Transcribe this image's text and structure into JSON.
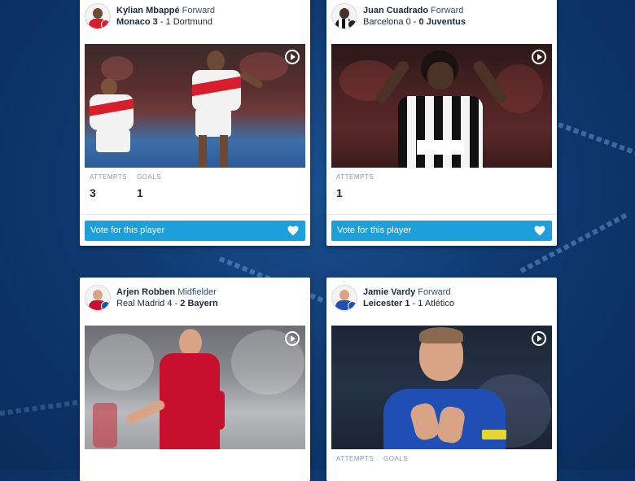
{
  "cards": [
    {
      "player_name": "Kylian Mbappé",
      "position": "Forward",
      "home_team": "Monaco",
      "home_score": "3",
      "away_score": "1",
      "away_team": "Dortmund",
      "winner": "home",
      "stats": [
        {
          "label": "ATTEMPTS",
          "value": "3"
        },
        {
          "label": "GOALS",
          "value": "1"
        }
      ],
      "vote_label": "Vote for this player",
      "play_icon": "play-icon"
    },
    {
      "player_name": "Juan Cuadrado",
      "position": "Forward",
      "home_team": "Barcelona",
      "home_score": "0",
      "away_score": "0",
      "away_team": "Juventus",
      "winner": "away",
      "stats": [
        {
          "label": "ATTEMPTS",
          "value": "1"
        }
      ],
      "vote_label": "Vote for this player",
      "play_icon": "play-icon"
    },
    {
      "player_name": "Arjen Robben",
      "position": "Midfielder",
      "home_team": "Real Madrid",
      "home_score": "4",
      "away_score": "2",
      "away_team": "Bayern",
      "winner": "away",
      "play_icon": "play-icon"
    },
    {
      "player_name": "Jamie Vardy",
      "position": "Forward",
      "home_team": "Leicester",
      "home_score": "1",
      "away_score": "1",
      "away_team": "Atlético",
      "winner": "home",
      "stats": [
        {
          "label": "ATTEMPTS",
          "value": ""
        },
        {
          "label": "GOALS",
          "value": ""
        }
      ],
      "play_icon": "play-icon"
    }
  ],
  "colors": {
    "background": "#0f3a72",
    "vote_button": "#1d9fdc",
    "monaco_red": "#d81e2c",
    "bayern_red": "#c8102e",
    "leicester_blue": "#1f4fb5"
  }
}
